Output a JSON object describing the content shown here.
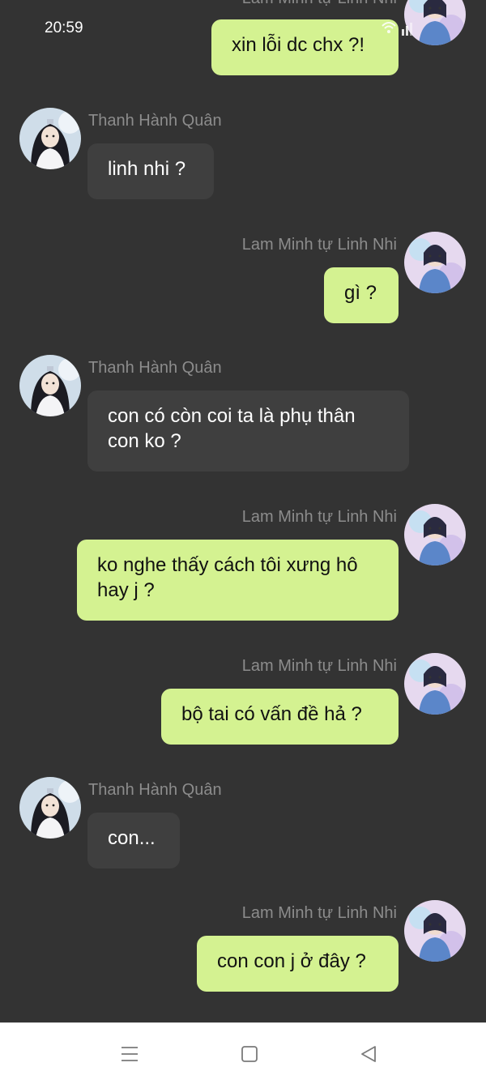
{
  "status_bar": {
    "time": "20:59"
  },
  "contacts": {
    "self": "Lam Minh tự Linh Nhi",
    "other": "Thanh Hành Quân"
  },
  "messages": [
    {
      "from": "self",
      "name": "Lam Minh tự Linh Nhi",
      "text": "xin lỗi dc chx ?!"
    },
    {
      "from": "other",
      "name": "Thanh Hành Quân",
      "text": "linh nhi ?"
    },
    {
      "from": "self",
      "name": "Lam Minh tự Linh Nhi",
      "text": "gì ?"
    },
    {
      "from": "other",
      "name": "Thanh Hành Quân",
      "text": "con có còn coi ta là phụ thân con ko ?"
    },
    {
      "from": "self",
      "name": "Lam Minh tự Linh Nhi",
      "text": "ko nghe thấy cách tôi xưng hô hay j ?"
    },
    {
      "from": "self",
      "name": "Lam Minh tự Linh Nhi",
      "text": "bộ tai có vấn đề hả ?"
    },
    {
      "from": "other",
      "name": "Thanh Hành Quân",
      "text": "con..."
    },
    {
      "from": "self",
      "name": "Lam Minh tự Linh Nhi",
      "text": "con con j ở đây ?"
    }
  ],
  "nav": {
    "icons": [
      "menu-icon",
      "home-icon",
      "back-icon"
    ]
  },
  "colors": {
    "background": "#333333",
    "bubble_out": "#d4f291",
    "bubble_in": "#3f3f3f",
    "name_text": "#8c8c8c"
  }
}
